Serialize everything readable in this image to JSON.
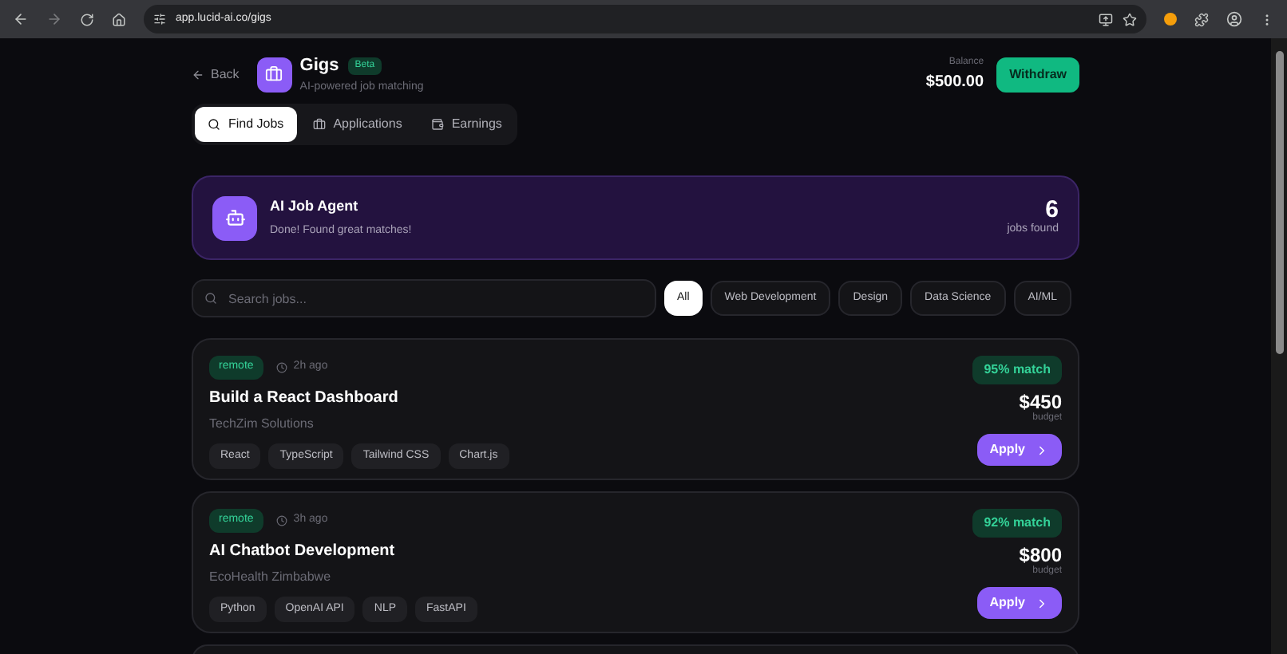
{
  "browser": {
    "url": "app.lucid-ai.co/gigs"
  },
  "header": {
    "back": "Back",
    "title": "Gigs",
    "badge": "Beta",
    "subtitle": "AI-powered job matching",
    "balance_label": "Balance",
    "balance": "$500.00",
    "withdraw": "Withdraw"
  },
  "tabs": [
    {
      "label": "Find Jobs",
      "kind": "search",
      "selected": true
    },
    {
      "label": "Applications",
      "kind": "briefcase",
      "selected": false
    },
    {
      "label": "Earnings",
      "kind": "wallet",
      "selected": false
    }
  ],
  "agent": {
    "title": "AI Job Agent",
    "status": "Done! Found great matches!",
    "count": "6",
    "count_label": "jobs found"
  },
  "search": {
    "placeholder": "Search jobs..."
  },
  "filters": [
    {
      "label": "All",
      "selected": true
    },
    {
      "label": "Web Development",
      "selected": false
    },
    {
      "label": "Design",
      "selected": false
    },
    {
      "label": "Data Science",
      "selected": false
    },
    {
      "label": "AI/ML",
      "selected": false
    }
  ],
  "jobs": [
    {
      "location": "remote",
      "posted": "2h ago",
      "title": "Build a React Dashboard",
      "company": "TechZim Solutions",
      "skills": [
        "React",
        "TypeScript",
        "Tailwind CSS",
        "Chart.js"
      ],
      "match": "95% match",
      "budget": "$450",
      "budget_label": "budget",
      "apply": "Apply"
    },
    {
      "location": "remote",
      "posted": "3h ago",
      "title": "AI Chatbot Development",
      "company": "EcoHealth Zimbabwe",
      "skills": [
        "Python",
        "OpenAI API",
        "NLP",
        "FastAPI"
      ],
      "match": "92% match",
      "budget": "$800",
      "budget_label": "budget",
      "apply": "Apply"
    }
  ]
}
